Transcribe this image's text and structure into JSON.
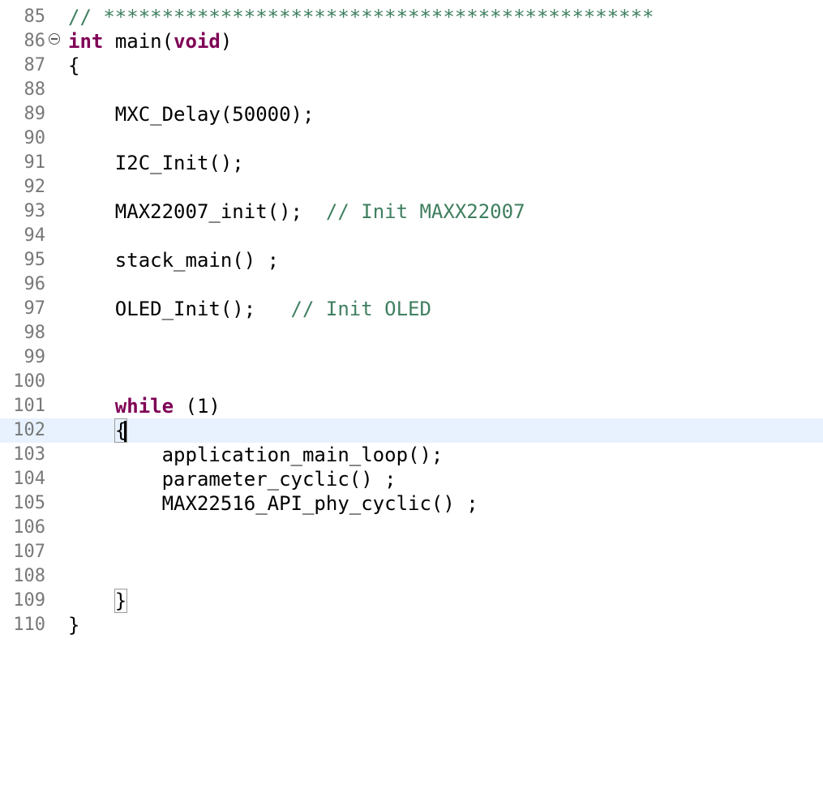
{
  "editor": {
    "language": "C",
    "current_line": "102",
    "colors": {
      "keyword": "#7f0055",
      "comment": "#3f7f5f",
      "line_number": "#787878",
      "current_line_bg": "#e8f2fe"
    },
    "lines": [
      {
        "num": "85",
        "tokens": [
          {
            "t": "// ***********************************************",
            "k": "cm"
          }
        ]
      },
      {
        "num": "86",
        "fold": true,
        "tokens": [
          {
            "t": "int",
            "k": "kw"
          },
          {
            "t": " "
          },
          {
            "t": "main",
            "k": "fn"
          },
          {
            "t": "("
          },
          {
            "t": "void",
            "k": "kw"
          },
          {
            "t": ")"
          }
        ]
      },
      {
        "num": "87",
        "tokens": [
          {
            "t": "{"
          }
        ]
      },
      {
        "num": "88",
        "tokens": []
      },
      {
        "num": "89",
        "tokens": [
          {
            "t": "    MXC_Delay(50000);"
          }
        ]
      },
      {
        "num": "90",
        "tokens": []
      },
      {
        "num": "91",
        "tokens": [
          {
            "t": "    I2C_Init();"
          }
        ]
      },
      {
        "num": "92",
        "tokens": []
      },
      {
        "num": "93",
        "tokens": [
          {
            "t": "    MAX22007_init();  "
          },
          {
            "t": "// Init MAXX22007",
            "k": "cm"
          }
        ]
      },
      {
        "num": "94",
        "tokens": []
      },
      {
        "num": "95",
        "tokens": [
          {
            "t": "    stack_main() ;"
          }
        ]
      },
      {
        "num": "96",
        "tokens": []
      },
      {
        "num": "97",
        "tokens": [
          {
            "t": "    OLED_Init();   "
          },
          {
            "t": "// Init OLED",
            "k": "cm"
          }
        ]
      },
      {
        "num": "98",
        "tokens": []
      },
      {
        "num": "99",
        "tokens": []
      },
      {
        "num": "100",
        "tokens": []
      },
      {
        "num": "101",
        "tokens": [
          {
            "t": "    "
          },
          {
            "t": "while",
            "k": "kw"
          },
          {
            "t": " (1)"
          }
        ]
      },
      {
        "num": "102",
        "current": true,
        "tokens": [
          {
            "t": "    "
          },
          {
            "t": "{",
            "k": "brace"
          },
          {
            "t": "",
            "k": "caret"
          }
        ]
      },
      {
        "num": "103",
        "tokens": [
          {
            "t": "        application_main_loop();"
          }
        ]
      },
      {
        "num": "104",
        "tokens": [
          {
            "t": "        parameter_cyclic() ;"
          }
        ]
      },
      {
        "num": "105",
        "tokens": [
          {
            "t": "        MAX22516_API_phy_cyclic() ;"
          }
        ]
      },
      {
        "num": "106",
        "tokens": []
      },
      {
        "num": "107",
        "tokens": []
      },
      {
        "num": "108",
        "tokens": []
      },
      {
        "num": "109",
        "tokens": [
          {
            "t": "    "
          },
          {
            "t": "}",
            "k": "brace"
          }
        ]
      },
      {
        "num": "110",
        "tokens": [
          {
            "t": "}"
          }
        ]
      }
    ]
  }
}
